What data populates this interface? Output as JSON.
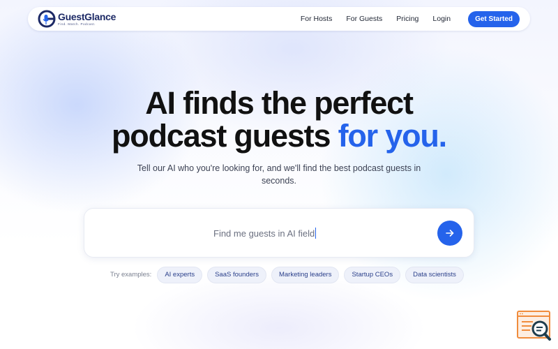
{
  "header": {
    "logo_name": "GuestGlance",
    "logo_tagline": "Find. Match. Podcast.",
    "nav": [
      "For Hosts",
      "For Guests",
      "Pricing",
      "Login"
    ],
    "cta_label": "Get Started"
  },
  "hero": {
    "headline_line1": "AI finds the perfect",
    "headline_line2_plain": "podcast guests",
    "headline_line2_accent": "for you.",
    "subtext_line1": "Tell our AI who you're looking for, and we'll find the best podcast guests in",
    "subtext_line2": "seconds."
  },
  "search": {
    "value": "Find me guests in AI field",
    "submit_icon": "arrow-right-icon"
  },
  "examples": {
    "label": "Try examples:",
    "items": [
      "AI experts",
      "SaaS founders",
      "Marketing leaders",
      "Startup CEOs",
      "Data scientists"
    ]
  },
  "colors": {
    "accent": "#2563eb",
    "brand_navy": "#1d2a66",
    "widget_orange": "#f08c3c"
  }
}
